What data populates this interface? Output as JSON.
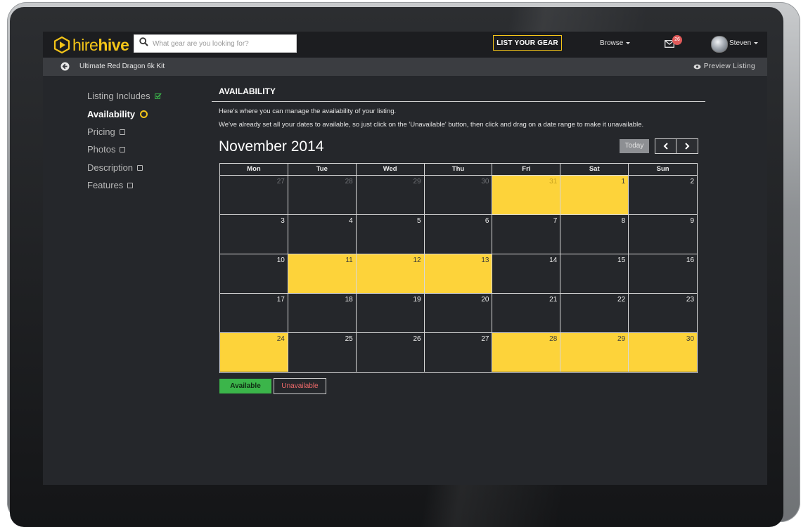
{
  "app": {
    "logo_hire": "hire",
    "logo_hive": "hive",
    "search_placeholder": "What gear are you looking for?",
    "list_gear_label": "LIST YOUR GEAR",
    "browse_label": "Browse",
    "mail_badge": "26",
    "user_name": "Steven",
    "icons": {
      "search": "search-icon",
      "mail": "envelope-icon",
      "back": "back-arrow-icon",
      "preview": "eye-icon"
    },
    "colors": {
      "accent": "#f5c518",
      "available": "#fdd33a",
      "green": "#3bb54a",
      "red": "#f06a6a"
    }
  },
  "subbar": {
    "kit_name": "Ultimate Red Dragon 6k Kit",
    "preview_label": "Preview Listing"
  },
  "sidebar": {
    "items": [
      {
        "label": "Listing Includes",
        "status": "check"
      },
      {
        "label": "Availability",
        "status": "current"
      },
      {
        "label": "Pricing",
        "status": "empty"
      },
      {
        "label": "Photos",
        "status": "empty"
      },
      {
        "label": "Description",
        "status": "empty"
      },
      {
        "label": "Features",
        "status": "empty"
      }
    ]
  },
  "content": {
    "title": "AVAILABILITY",
    "para1": "Here's where you can manage the availability of your listing.",
    "para2": "We've already set all your dates to available, so just click on the 'Unavailable' button, then click and drag on a date range to make it unavailable.",
    "month": "November 2014",
    "today_label": "Today"
  },
  "calendar": {
    "weekdays": [
      "Mon",
      "Tue",
      "Wed",
      "Thu",
      "Fri",
      "Sat",
      "Sun"
    ],
    "weeks": [
      [
        {
          "d": "27",
          "o": true
        },
        {
          "d": "28",
          "o": true
        },
        {
          "d": "29",
          "o": true
        },
        {
          "d": "30",
          "o": true
        },
        {
          "d": "31",
          "o": true,
          "a": true
        },
        {
          "d": "1",
          "a": true
        },
        {
          "d": "2"
        }
      ],
      [
        {
          "d": "3"
        },
        {
          "d": "4"
        },
        {
          "d": "5"
        },
        {
          "d": "6"
        },
        {
          "d": "7"
        },
        {
          "d": "8"
        },
        {
          "d": "9"
        }
      ],
      [
        {
          "d": "10"
        },
        {
          "d": "11",
          "a": true
        },
        {
          "d": "12",
          "a": true
        },
        {
          "d": "13",
          "a": true
        },
        {
          "d": "14"
        },
        {
          "d": "15"
        },
        {
          "d": "16"
        }
      ],
      [
        {
          "d": "17"
        },
        {
          "d": "18"
        },
        {
          "d": "19"
        },
        {
          "d": "20"
        },
        {
          "d": "21"
        },
        {
          "d": "22"
        },
        {
          "d": "23"
        }
      ],
      [
        {
          "d": "24",
          "a": true
        },
        {
          "d": "25"
        },
        {
          "d": "26"
        },
        {
          "d": "27"
        },
        {
          "d": "28",
          "a": true
        },
        {
          "d": "29",
          "a": true
        },
        {
          "d": "30",
          "a": true
        }
      ]
    ]
  },
  "legend": {
    "available_label": "Available",
    "unavailable_label": "Unavailable"
  }
}
